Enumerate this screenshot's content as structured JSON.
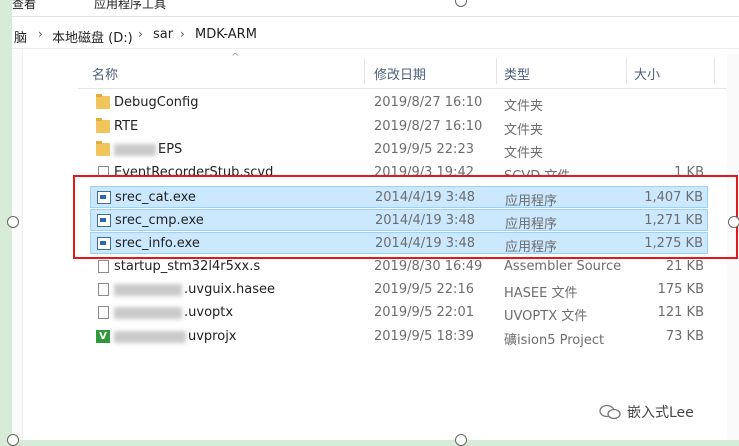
{
  "top_menu": {
    "left_fragment": "查看",
    "right_fragment": "应用程序工具"
  },
  "breadcrumb": {
    "left_fragment": "脑",
    "items": [
      "本地磁盘 (D:)",
      "sar",
      "MDK-ARM"
    ]
  },
  "columns": {
    "name": "名称",
    "modified": "修改日期",
    "type": "类型",
    "size": "大小"
  },
  "files": [
    {
      "name": "DebugConfig",
      "date": "2019/8/27 16:10",
      "type": "文件夹",
      "size": "",
      "icon": "folder-icon",
      "selected": false
    },
    {
      "name": "RTE",
      "date": "2019/8/27 16:10",
      "type": "文件夹",
      "size": "",
      "icon": "folder-icon",
      "selected": false
    },
    {
      "name": "EPS",
      "date": "2019/9/5 22:23",
      "type": "文件夹",
      "size": "",
      "icon": "folder-icon",
      "selected": false,
      "redacted_prefix": true
    },
    {
      "name": "EventRecorderStub.scvd",
      "date": "2019/9/3 19:42",
      "type": "SCVD 文件",
      "size": "1 KB",
      "icon": "file-icon",
      "selected": false
    },
    {
      "name": "srec_cat.exe",
      "date": "2014/4/19 3:48",
      "type": "应用程序",
      "size": "1,407 KB",
      "icon": "exe-icon",
      "selected": true
    },
    {
      "name": "srec_cmp.exe",
      "date": "2014/4/19 3:48",
      "type": "应用程序",
      "size": "1,271 KB",
      "icon": "exe-icon",
      "selected": true
    },
    {
      "name": "srec_info.exe",
      "date": "2014/4/19 3:48",
      "type": "应用程序",
      "size": "1,275 KB",
      "icon": "exe-icon",
      "selected": true
    },
    {
      "name": "startup_stm32l4r5xx.s",
      "date": "2019/8/30 16:49",
      "type": "Assembler Source",
      "size": "21 KB",
      "icon": "file-icon",
      "selected": false
    },
    {
      "name": ".uvguix.hasee",
      "date": "2019/9/5 22:16",
      "type": "HASEE 文件",
      "size": "175 KB",
      "icon": "file-icon",
      "selected": false,
      "redacted_prefix": true
    },
    {
      "name": ".uvoptx",
      "date": "2019/9/5 22:01",
      "type": "UVOPTX 文件",
      "size": "121 KB",
      "icon": "file-icon",
      "selected": false,
      "redacted_prefix": true
    },
    {
      "name": "uvprojx",
      "date": "2019/9/5 18:39",
      "type": "礦ision5 Project",
      "size": "73 KB",
      "icon": "uvision-icon",
      "selected": false,
      "redacted_prefix": true
    }
  ],
  "watermark": {
    "text": "嵌入式Lee"
  },
  "colors": {
    "selection": "#cce8ff",
    "selection_border": "#99d1ff",
    "highlight_box": "#e3171c",
    "folder": "#f2c55c"
  }
}
